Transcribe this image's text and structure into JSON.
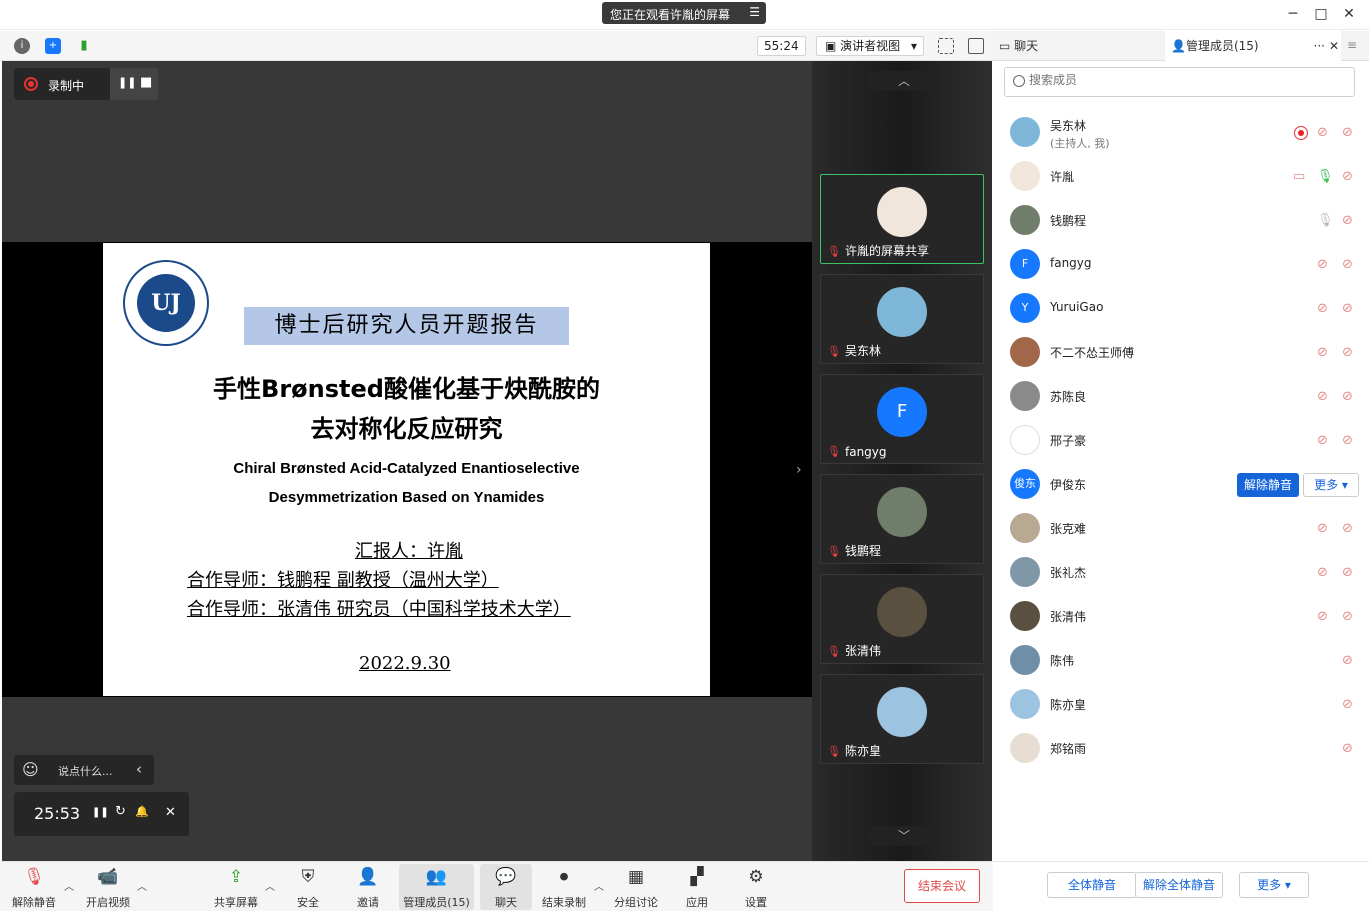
{
  "banner": {
    "text": "您正在观看许胤的屏幕",
    "icon": "list-icon"
  },
  "window": {
    "minimize": "─",
    "maximize": "□",
    "close": "✕"
  },
  "toolbar": {
    "timer": "55:24",
    "view_label": "演讲者视图",
    "view_caret": "▾"
  },
  "tabs": [
    {
      "label": "聊天",
      "icon": "chat-icon"
    },
    {
      "label": "管理成员(15)",
      "icon": "person-icon"
    }
  ],
  "tab_more": "···",
  "tab_close": "✕",
  "recording": {
    "label": "录制中",
    "pause": "❚❚",
    "stop": "■"
  },
  "slide": {
    "logo_text": "UJ",
    "tag": "博士后研究人员开题报告",
    "title_zh_1": "手性Brønsted酸催化基于炔酰胺的",
    "title_zh_2": "去对称化反应研究",
    "title_en_1": "Chiral Brønsted Acid-Catalyzed Enantioselective",
    "title_en_2": "Desymmetrization Based on Ynamides",
    "reporter": "汇报人：许胤",
    "advisor_1": "合作导师：钱鹏程 副教授（温州大学）",
    "advisor_2": "合作导师：张清伟 研究员（中国科学技术大学）",
    "date": "2022.9.30"
  },
  "chat_input": {
    "placeholder": "说点什么...",
    "emoji": "☺",
    "collapse": "‹"
  },
  "countdown": {
    "time": "25:53",
    "pause": "❚❚",
    "reset": "↻",
    "bell": "🔔",
    "close": "✕"
  },
  "strip": {
    "up": "︿",
    "down": "﹀",
    "tiles": [
      {
        "name": "许胤的屏幕共享",
        "avatar_color": "#f0e6dc",
        "active": true
      },
      {
        "name": "吴东林",
        "avatar_color": "#7fb7d8",
        "active": false
      },
      {
        "name": "fangyg",
        "avatar_color": "#1677ff",
        "initial": "F",
        "active": false
      },
      {
        "name": "钱鹏程",
        "avatar_color": "#6f7d6a",
        "active": false
      },
      {
        "name": "张清伟",
        "avatar_color": "#5a5040",
        "active": false
      },
      {
        "name": "陈亦皇",
        "avatar_color": "#9cc3e0",
        "active": false
      }
    ]
  },
  "search": {
    "placeholder": "搜索成员"
  },
  "members": [
    {
      "name": "吴东林",
      "role": "(主持人, 我)",
      "avatar_color": "#7fb7d8",
      "mic": "off",
      "recording": true
    },
    {
      "name": "许胤",
      "avatar_color": "#f0e6dc",
      "mic": "on",
      "sharing": true
    },
    {
      "name": "钱鹏程",
      "avatar_color": "#6f7d6a",
      "mic": "idle"
    },
    {
      "name": "fangyg",
      "avatar_color": "#1677ff",
      "initial": "F",
      "mic": "off"
    },
    {
      "name": "YuruiGao",
      "avatar_color": "#1677ff",
      "initial": "Y",
      "mic": "off"
    },
    {
      "name": "不二不怂王师傅",
      "avatar_color": "#a0674a",
      "mic": "off"
    },
    {
      "name": "苏陈良",
      "avatar_color": "#8a8a8a",
      "mic": "off"
    },
    {
      "name": "邢子豪",
      "avatar_color": "#ffffff",
      "mic": "off"
    },
    {
      "name": "伊俊东",
      "avatar_color": "#1677ff",
      "initial": "俊东",
      "mic": "actions"
    },
    {
      "name": "张克难",
      "avatar_color": "#b9a892",
      "mic": "off"
    },
    {
      "name": "张礼杰",
      "avatar_color": "#7f98a8",
      "mic": "off"
    },
    {
      "name": "张清伟",
      "avatar_color": "#5a5040",
      "mic": "off"
    },
    {
      "name": "陈伟",
      "avatar_color": "#6f8ea8",
      "mic": "none"
    },
    {
      "name": "陈亦皇",
      "avatar_color": "#9cc3e0",
      "mic": "none"
    },
    {
      "name": "郑铭雨",
      "avatar_color": "#e8ddd2",
      "mic": "none"
    }
  ],
  "member_actions": {
    "unmute": "解除静音",
    "more": "更多 ▾"
  },
  "footer": {
    "mute_all": "全体静音",
    "unmute_all": "解除全体静音",
    "more": "更多 ▾"
  },
  "controls": [
    {
      "label": "解除静音",
      "icon": "mic-off-icon",
      "glyph": "🎙"
    },
    {
      "label": "开启视频",
      "icon": "video-off-icon",
      "glyph": "📹"
    },
    {
      "label": "共享屏幕",
      "icon": "share-screen-icon",
      "glyph": "⇪"
    },
    {
      "label": "安全",
      "icon": "shield-icon",
      "glyph": "⛨"
    },
    {
      "label": "邀请",
      "icon": "invite-icon",
      "glyph": "👤"
    },
    {
      "label": "管理成员(15)",
      "icon": "members-icon",
      "glyph": "👥"
    },
    {
      "label": "聊天",
      "icon": "chat-icon",
      "glyph": "💬"
    },
    {
      "label": "结束录制",
      "icon": "stop-record-icon",
      "glyph": "⏺"
    },
    {
      "label": "分组讨论",
      "icon": "breakout-icon",
      "glyph": "▦"
    },
    {
      "label": "应用",
      "icon": "apps-icon",
      "glyph": "▞"
    },
    {
      "label": "设置",
      "icon": "settings-icon",
      "glyph": "⚙"
    }
  ],
  "end_meeting": "结束会议",
  "colors": {
    "accent": "#1665d8",
    "danger": "#e04a4a",
    "active_border": "#3cc36a"
  }
}
